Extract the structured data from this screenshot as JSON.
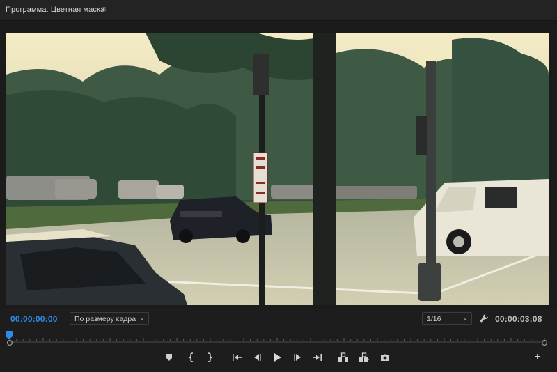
{
  "panel": {
    "title": "Программа: Цветная маска",
    "menu_icon": "≡"
  },
  "controls": {
    "current_timecode": "00:00:00:00",
    "fit_label": "По размеру кадра",
    "resolution_label": "1/16",
    "duration_timecode": "00:00:03:08",
    "dropdown_glyph": "⌄"
  },
  "transport": {
    "buttons": [
      "add-marker",
      "mark-in",
      "mark-out",
      "go-to-in",
      "step-back",
      "play",
      "step-forward",
      "go-to-out",
      "lift",
      "extract",
      "export-frame"
    ],
    "add_label": "+"
  },
  "colors": {
    "timecode_accent": "#2d8ceb",
    "playhead": "#2d8ceb",
    "panel_bg": "#1d1d1d"
  },
  "playback": {
    "playhead_fraction": 0.0
  }
}
